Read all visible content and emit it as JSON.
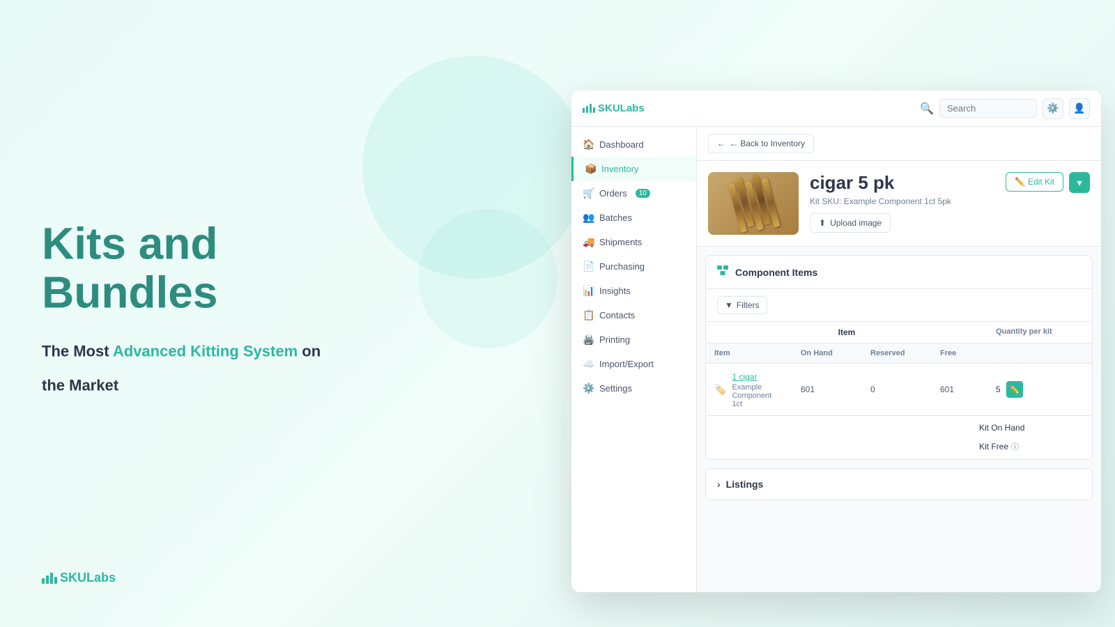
{
  "hero": {
    "title": "Kits and Bundles",
    "subtitle_normal": "The Most ",
    "subtitle_highlight": "Advanced Kitting System",
    "subtitle_rest": " on",
    "subtitle_line2": "the Market"
  },
  "bottom_logo": {
    "text_normal": "SKU",
    "text_highlight": "Labs"
  },
  "topbar": {
    "logo_normal": "SKU",
    "logo_highlight": "Labs",
    "search_placeholder": "Search"
  },
  "sidebar": {
    "items": [
      {
        "id": "dashboard",
        "label": "Dashboard",
        "icon": "🏠",
        "active": false
      },
      {
        "id": "inventory",
        "label": "Inventory",
        "icon": "📦",
        "active": true
      },
      {
        "id": "orders",
        "label": "Orders",
        "icon": "🛒",
        "badge": "10",
        "active": false
      },
      {
        "id": "batches",
        "label": "Batches",
        "icon": "👥",
        "active": false
      },
      {
        "id": "shipments",
        "label": "Shipments",
        "icon": "🚚",
        "active": false
      },
      {
        "id": "purchasing",
        "label": "Purchasing",
        "icon": "📄",
        "active": false
      },
      {
        "id": "insights",
        "label": "Insights",
        "icon": "📊",
        "active": false
      },
      {
        "id": "contacts",
        "label": "Contacts",
        "icon": "📋",
        "active": false
      },
      {
        "id": "printing",
        "label": "Printing",
        "icon": "🖨️",
        "active": false
      },
      {
        "id": "import-export",
        "label": "Import/Export",
        "icon": "☁️",
        "active": false
      },
      {
        "id": "settings",
        "label": "Settings",
        "icon": "⚙️",
        "active": false
      }
    ]
  },
  "back_button": "← Back to Inventory",
  "kit": {
    "title": "cigar 5 pk",
    "sku_label": "Kit SKU:",
    "sku_value": "Example Component 1ct 5pk",
    "edit_btn": "Edit Kit",
    "upload_btn": "Upload image"
  },
  "component_section": {
    "title": "Component Items",
    "filter_btn": "Filters",
    "table": {
      "header": "Item",
      "columns": [
        "Item",
        "On Hand",
        "Reserved",
        "Free",
        "Quantity per kit"
      ],
      "rows": [
        {
          "item_name": "1 cigar",
          "item_sub": "Example Component 1ct",
          "on_hand": "601",
          "reserved": "0",
          "free": "601",
          "qty": "5"
        }
      ],
      "kit_on_hand_label": "Kit On Hand",
      "kit_free_label": "Kit Free",
      "kit_free_info": "ⓘ"
    }
  },
  "listings": {
    "title": "Listings"
  }
}
